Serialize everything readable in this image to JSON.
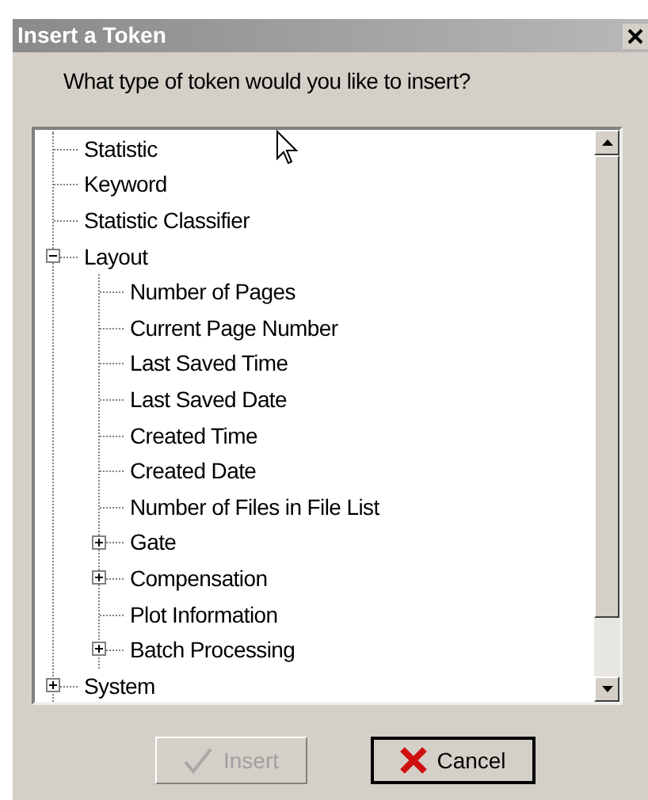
{
  "window": {
    "title": "Insert a Token"
  },
  "prompt": "What type of token would you like to insert?",
  "tree": [
    {
      "kind": "leaf",
      "label": "Statistic"
    },
    {
      "kind": "leaf",
      "label": "Keyword"
    },
    {
      "kind": "leaf",
      "label": "Statistic Classifier"
    },
    {
      "kind": "group",
      "label": "Layout",
      "expanded": true,
      "children": [
        {
          "kind": "leaf",
          "label": "Number of Pages"
        },
        {
          "kind": "leaf",
          "label": "Current Page Number"
        },
        {
          "kind": "leaf",
          "label": "Last Saved Time"
        },
        {
          "kind": "leaf",
          "label": "Last Saved Date"
        },
        {
          "kind": "leaf",
          "label": "Created Time"
        },
        {
          "kind": "leaf",
          "label": "Created Date"
        },
        {
          "kind": "leaf",
          "label": "Number of Files in File List"
        },
        {
          "kind": "group",
          "label": "Gate",
          "expanded": false
        },
        {
          "kind": "group",
          "label": "Compensation",
          "expanded": false
        },
        {
          "kind": "leaf",
          "label": "Plot Information"
        },
        {
          "kind": "group",
          "label": "Batch Processing",
          "expanded": false
        }
      ]
    },
    {
      "kind": "group",
      "label": "System",
      "expanded": false
    }
  ],
  "buttons": [
    {
      "kind": "insert",
      "label": "Insert",
      "disabled": true
    },
    {
      "kind": "cancel",
      "label": "Cancel",
      "disabled": false
    }
  ]
}
